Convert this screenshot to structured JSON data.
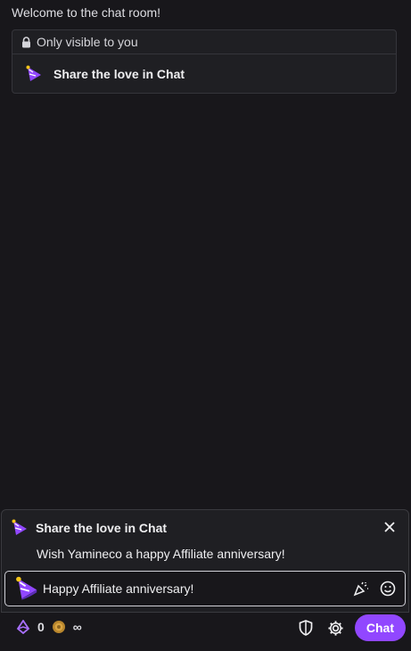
{
  "chat": {
    "welcome": "Welcome to the chat room!",
    "notice": {
      "visibility": "Only visible to you",
      "text": "Share the love in Chat"
    }
  },
  "share_card": {
    "title": "Share the love in Chat",
    "message": "Wish Yamineco a happy Affiliate anniversary!",
    "input_value": "Happy Affiliate anniversary!"
  },
  "bottom_bar": {
    "bits": "0",
    "channel_points": "∞",
    "chat_button": "Chat"
  },
  "colors": {
    "accent": "#9147ff",
    "background": "#18171b"
  },
  "icons": [
    "lock-icon",
    "party-hat-icon",
    "close-icon",
    "confetti-icon",
    "emoji-icon",
    "bits-icon",
    "channel-points-icon",
    "shield-icon",
    "gear-icon"
  ]
}
